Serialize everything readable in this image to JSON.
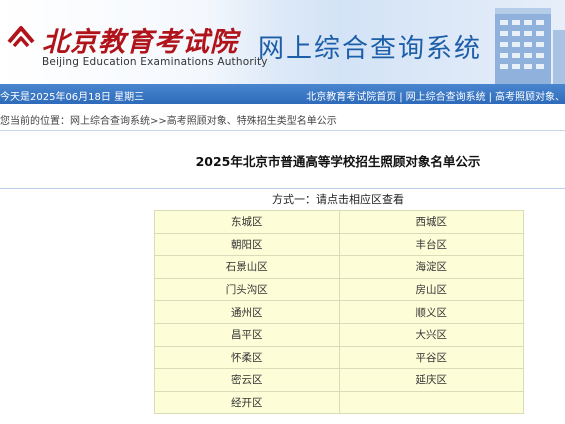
{
  "header": {
    "logo_cn": "北京教育考试院",
    "logo_en": "Beijing Education Examinations Authority",
    "system_title": "网上综合查询系统"
  },
  "navbar": {
    "date_text": "今天是2025年06月18日  星期三",
    "links": [
      "北京教育考试院首页",
      "网上综合查询系统",
      "高考照顾对象、"
    ]
  },
  "breadcrumb": {
    "prefix": "您当前的位置：",
    "items": [
      "网上综合查询系统",
      "高考照顾对象、特殊招生类型名单公示"
    ],
    "separator": ">>"
  },
  "page": {
    "title": "2025年北京市普通高等学校招生照顾对象名单公示",
    "method": "方式一：请点击相应区查看"
  },
  "districts": [
    [
      "东城区",
      "西城区"
    ],
    [
      "朝阳区",
      "丰台区"
    ],
    [
      "石景山区",
      "海淀区"
    ],
    [
      "门头沟区",
      "房山区"
    ],
    [
      "通州区",
      "顺义区"
    ],
    [
      "昌平区",
      "大兴区"
    ],
    [
      "怀柔区",
      "平谷区"
    ],
    [
      "密云区",
      "延庆区"
    ],
    [
      "经开区",
      ""
    ]
  ],
  "colors": {
    "brand_red": "#b0141a",
    "title_blue": "#1d5ea8",
    "nav_blue": "#3a78c4",
    "cell_bg": "#fdfdd8"
  }
}
